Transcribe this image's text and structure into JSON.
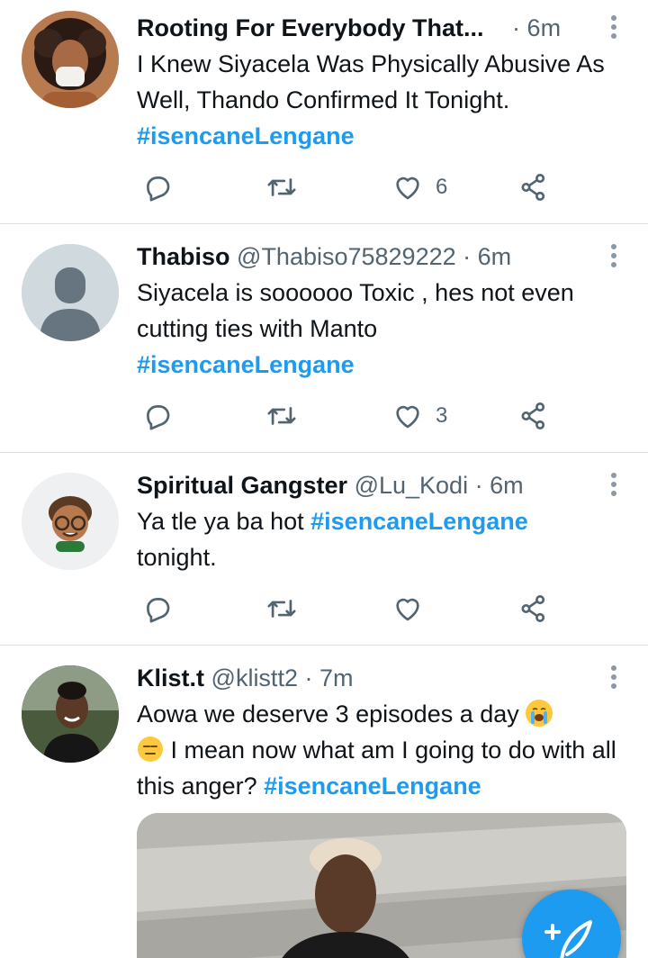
{
  "colors": {
    "accent": "#1d9bf0",
    "text": "#0f1419",
    "secondary": "#536471",
    "divider": "#dcdfe3"
  },
  "tweets": [
    {
      "name": "Rooting For Everybody That...",
      "handle": "",
      "separator": "·",
      "time": "6m",
      "text_1": "I Knew Siyacela Was Physically Abusive As Well, Thando Confirmed It Tonight.",
      "hashtag": "#isencaneLengane",
      "like_count": "6"
    },
    {
      "name": "Thabiso",
      "handle": "@Thabiso75829222",
      "separator": "·",
      "time": "6m",
      "text_1": "Siyacela is soooooo Toxic , hes not even cutting ties with Manto",
      "hashtag": "#isencaneLengane",
      "like_count": "3"
    },
    {
      "name": "Spiritual Gangster",
      "handle": "@Lu_Kodi",
      "separator": "·",
      "time": "6m",
      "text_1": "Ya tle ya ba hot ",
      "hashtag": "#isencaneLengane",
      "text_2": "tonight.",
      "like_count": ""
    },
    {
      "name": "Klist.t",
      "handle": "@klistt2",
      "separator": "·",
      "time": "7m",
      "text_1": "Aowa we deserve 3 episodes a day ",
      "text_2": " I mean now what am I going to do with all this anger? ",
      "hashtag": "#isencaneLengane",
      "emoji_1": "loudly-crying-face",
      "emoji_2": "expressionless-face"
    }
  ],
  "icons": {
    "reply": "reply-icon",
    "retweet": "retweet-icon",
    "like": "heart-icon",
    "share": "share-icon",
    "more": "more-vertical-icon",
    "compose": "compose-tweet-icon"
  }
}
